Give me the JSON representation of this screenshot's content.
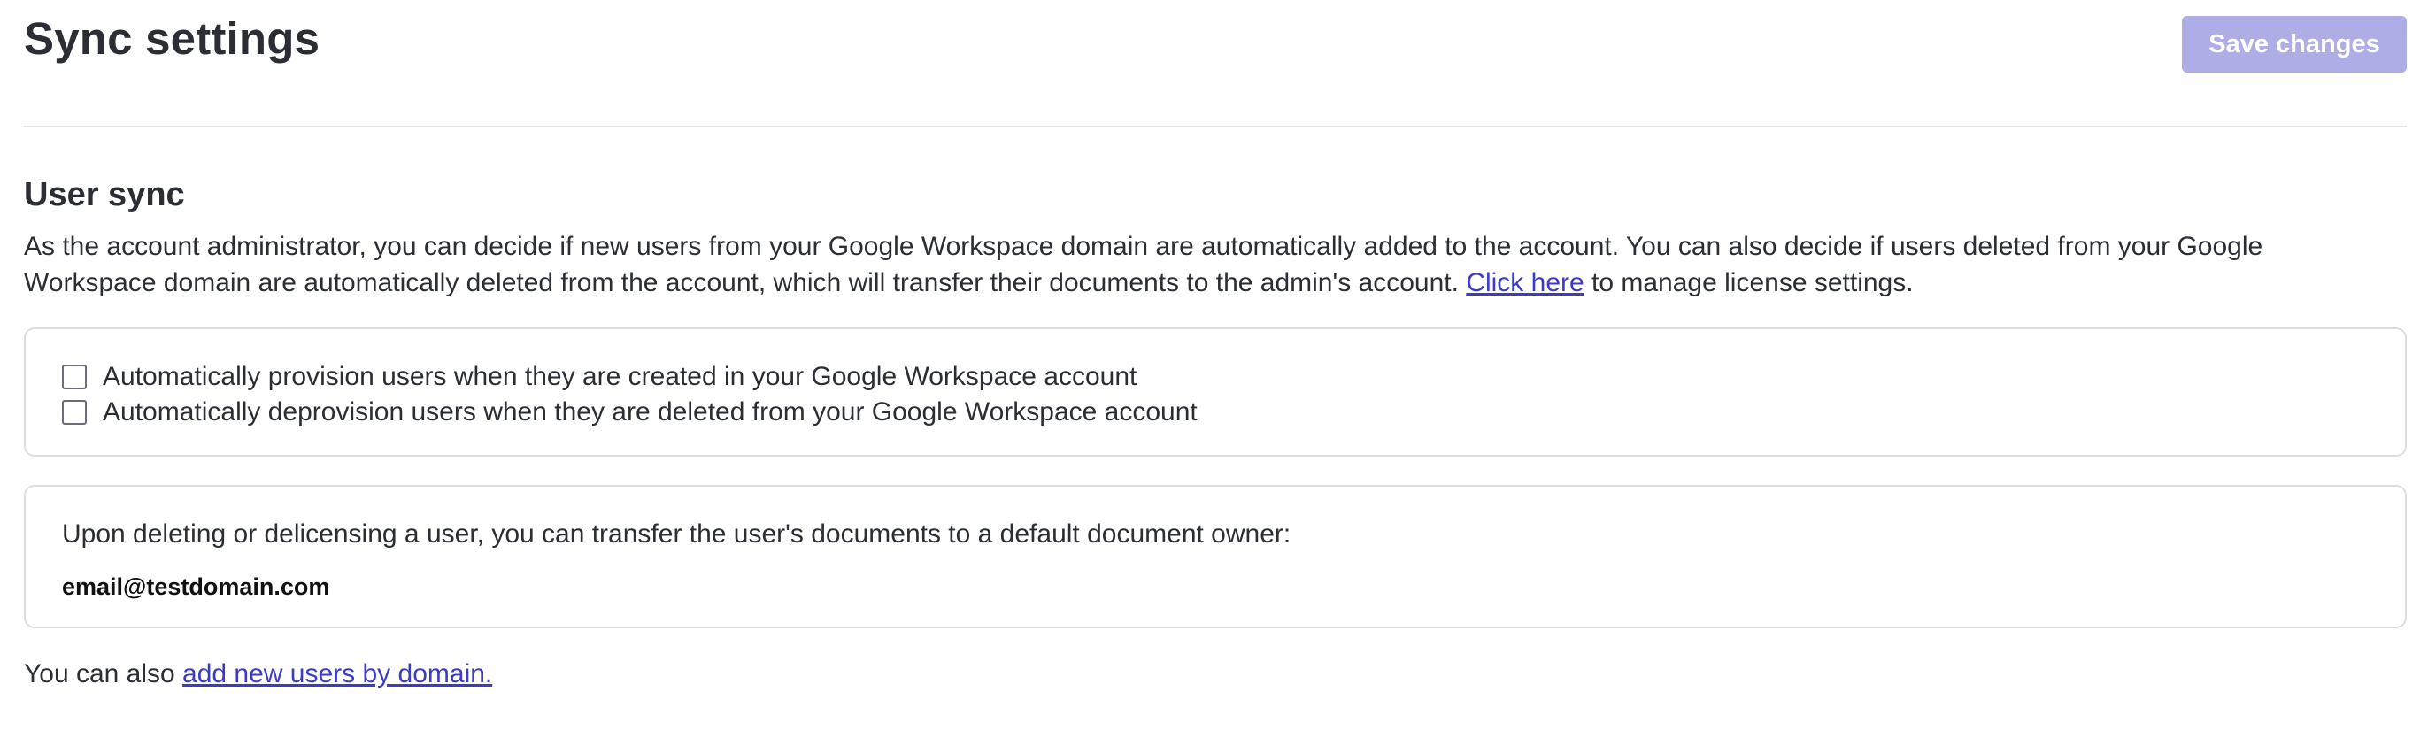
{
  "header": {
    "title": "Sync settings",
    "save_label": "Save changes"
  },
  "user_sync": {
    "title": "User sync",
    "description": "As the account administrator, you can decide if new users from your Google Workspace domain are automatically added to the account. You can also decide if users deleted from your Google Workspace domain are automatically deleted from the account, which will transfer their documents to the admin's account.",
    "link_label": "Click here",
    "link_suffix": "to manage license settings."
  },
  "options": {
    "provision_label": "Automatically provision users when they are created in your Google Workspace account",
    "provision_checked": false,
    "deprovision_label": "Automatically deprovision users when they are deleted from your Google Workspace account",
    "deprovision_checked": false
  },
  "default_owner": {
    "text": "Upon deleting or delicensing a user, you can transfer the user's documents to a default document owner:",
    "email": "email@testdomain.com"
  },
  "footer": {
    "prefix": "You can also",
    "link_label": "add new users by domain."
  },
  "colors": {
    "accent": "#3b3bc7",
    "save_button_disabled": "#aeaee6",
    "text": "#2b2e35",
    "border": "#dcdde2"
  }
}
